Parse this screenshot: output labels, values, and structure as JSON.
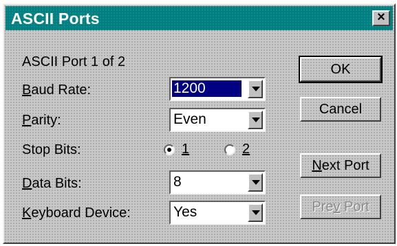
{
  "window": {
    "title": "ASCII Ports",
    "close_glyph": "×",
    "close_icon": "close-icon"
  },
  "port_info": "ASCII Port 1 of 2",
  "fields": {
    "baud_rate": {
      "label_pre": "",
      "label_acc": "B",
      "label_post": "aud Rate:",
      "value": "1200"
    },
    "parity": {
      "label_pre": "",
      "label_acc": "P",
      "label_post": "arity:",
      "value": "Even"
    },
    "stop_bits": {
      "label": "Stop Bits:",
      "options": [
        {
          "acc": "1",
          "selected": true
        },
        {
          "acc": "2",
          "selected": false
        }
      ]
    },
    "data_bits": {
      "label_pre": "",
      "label_acc": "D",
      "label_post": "ata Bits:",
      "value": "8"
    },
    "keyboard_device": {
      "label_pre": "",
      "label_acc": "K",
      "label_post": "eyboard Device:",
      "value": "Yes"
    }
  },
  "buttons": {
    "ok": "OK",
    "cancel": "Cancel",
    "next_port": {
      "acc": "N",
      "rest": "ext Port"
    },
    "prev_port": {
      "pre": "Pre",
      "acc": "v",
      "post": " Port"
    }
  },
  "colors": {
    "title_bar": "#008080",
    "selection": "#000080"
  }
}
